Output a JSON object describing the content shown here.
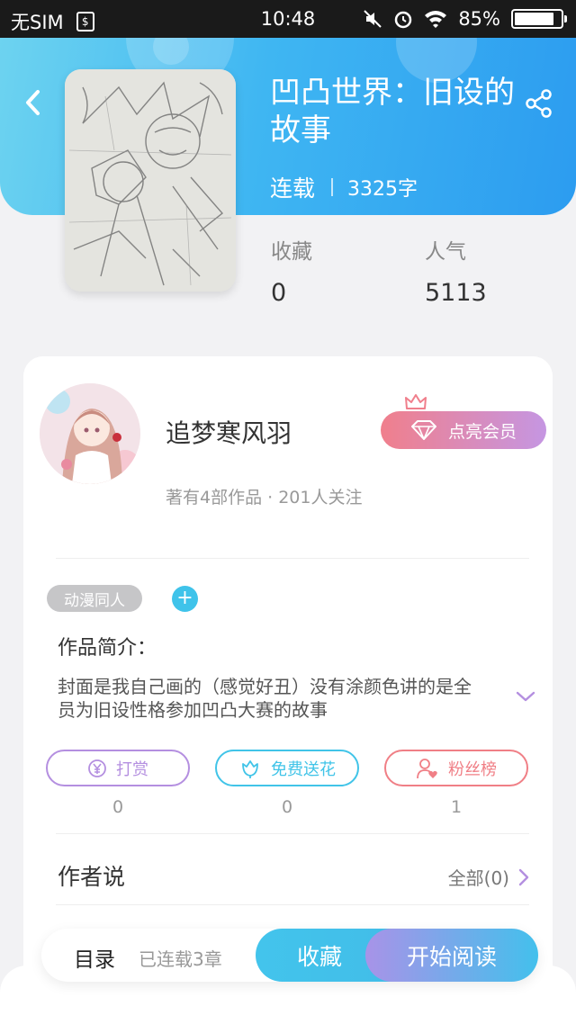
{
  "status_bar": {
    "carrier": "无SIM",
    "time": "10:48",
    "battery": "85%",
    "battery_level": 0.85
  },
  "book": {
    "title": "凹凸世界：旧设的故事",
    "status": "连载",
    "word_count": "3325字",
    "stats": [
      {
        "label": "收藏",
        "value": "0"
      },
      {
        "label": "人气",
        "value": "5113"
      }
    ]
  },
  "author": {
    "name": "追梦寒风羽",
    "summary": "著有4部作品 · 201人关注",
    "vip_label": "点亮会员"
  },
  "tags": [
    "动漫同人"
  ],
  "intro": {
    "label": "作品简介：",
    "text": "封面是我自己画的（感觉好丑）没有涂颜色讲的是全员为旧设性格参加凹凸大赛的故事"
  },
  "actions": [
    {
      "label": "打赏",
      "count": "0",
      "color": "#b48fe0",
      "icon": "yen-icon"
    },
    {
      "label": "免费送花",
      "count": "0",
      "color": "#41c4e8",
      "icon": "flower-icon"
    },
    {
      "label": "粉丝榜",
      "count": "1",
      "color": "#f07f86",
      "icon": "fan-icon"
    }
  ],
  "author_say": {
    "label": "作者说",
    "all": "全部(0)"
  },
  "bottom_bar": {
    "toc": "目录",
    "chapters": "已连载3章",
    "collect": "收藏",
    "read": "开始阅读"
  }
}
